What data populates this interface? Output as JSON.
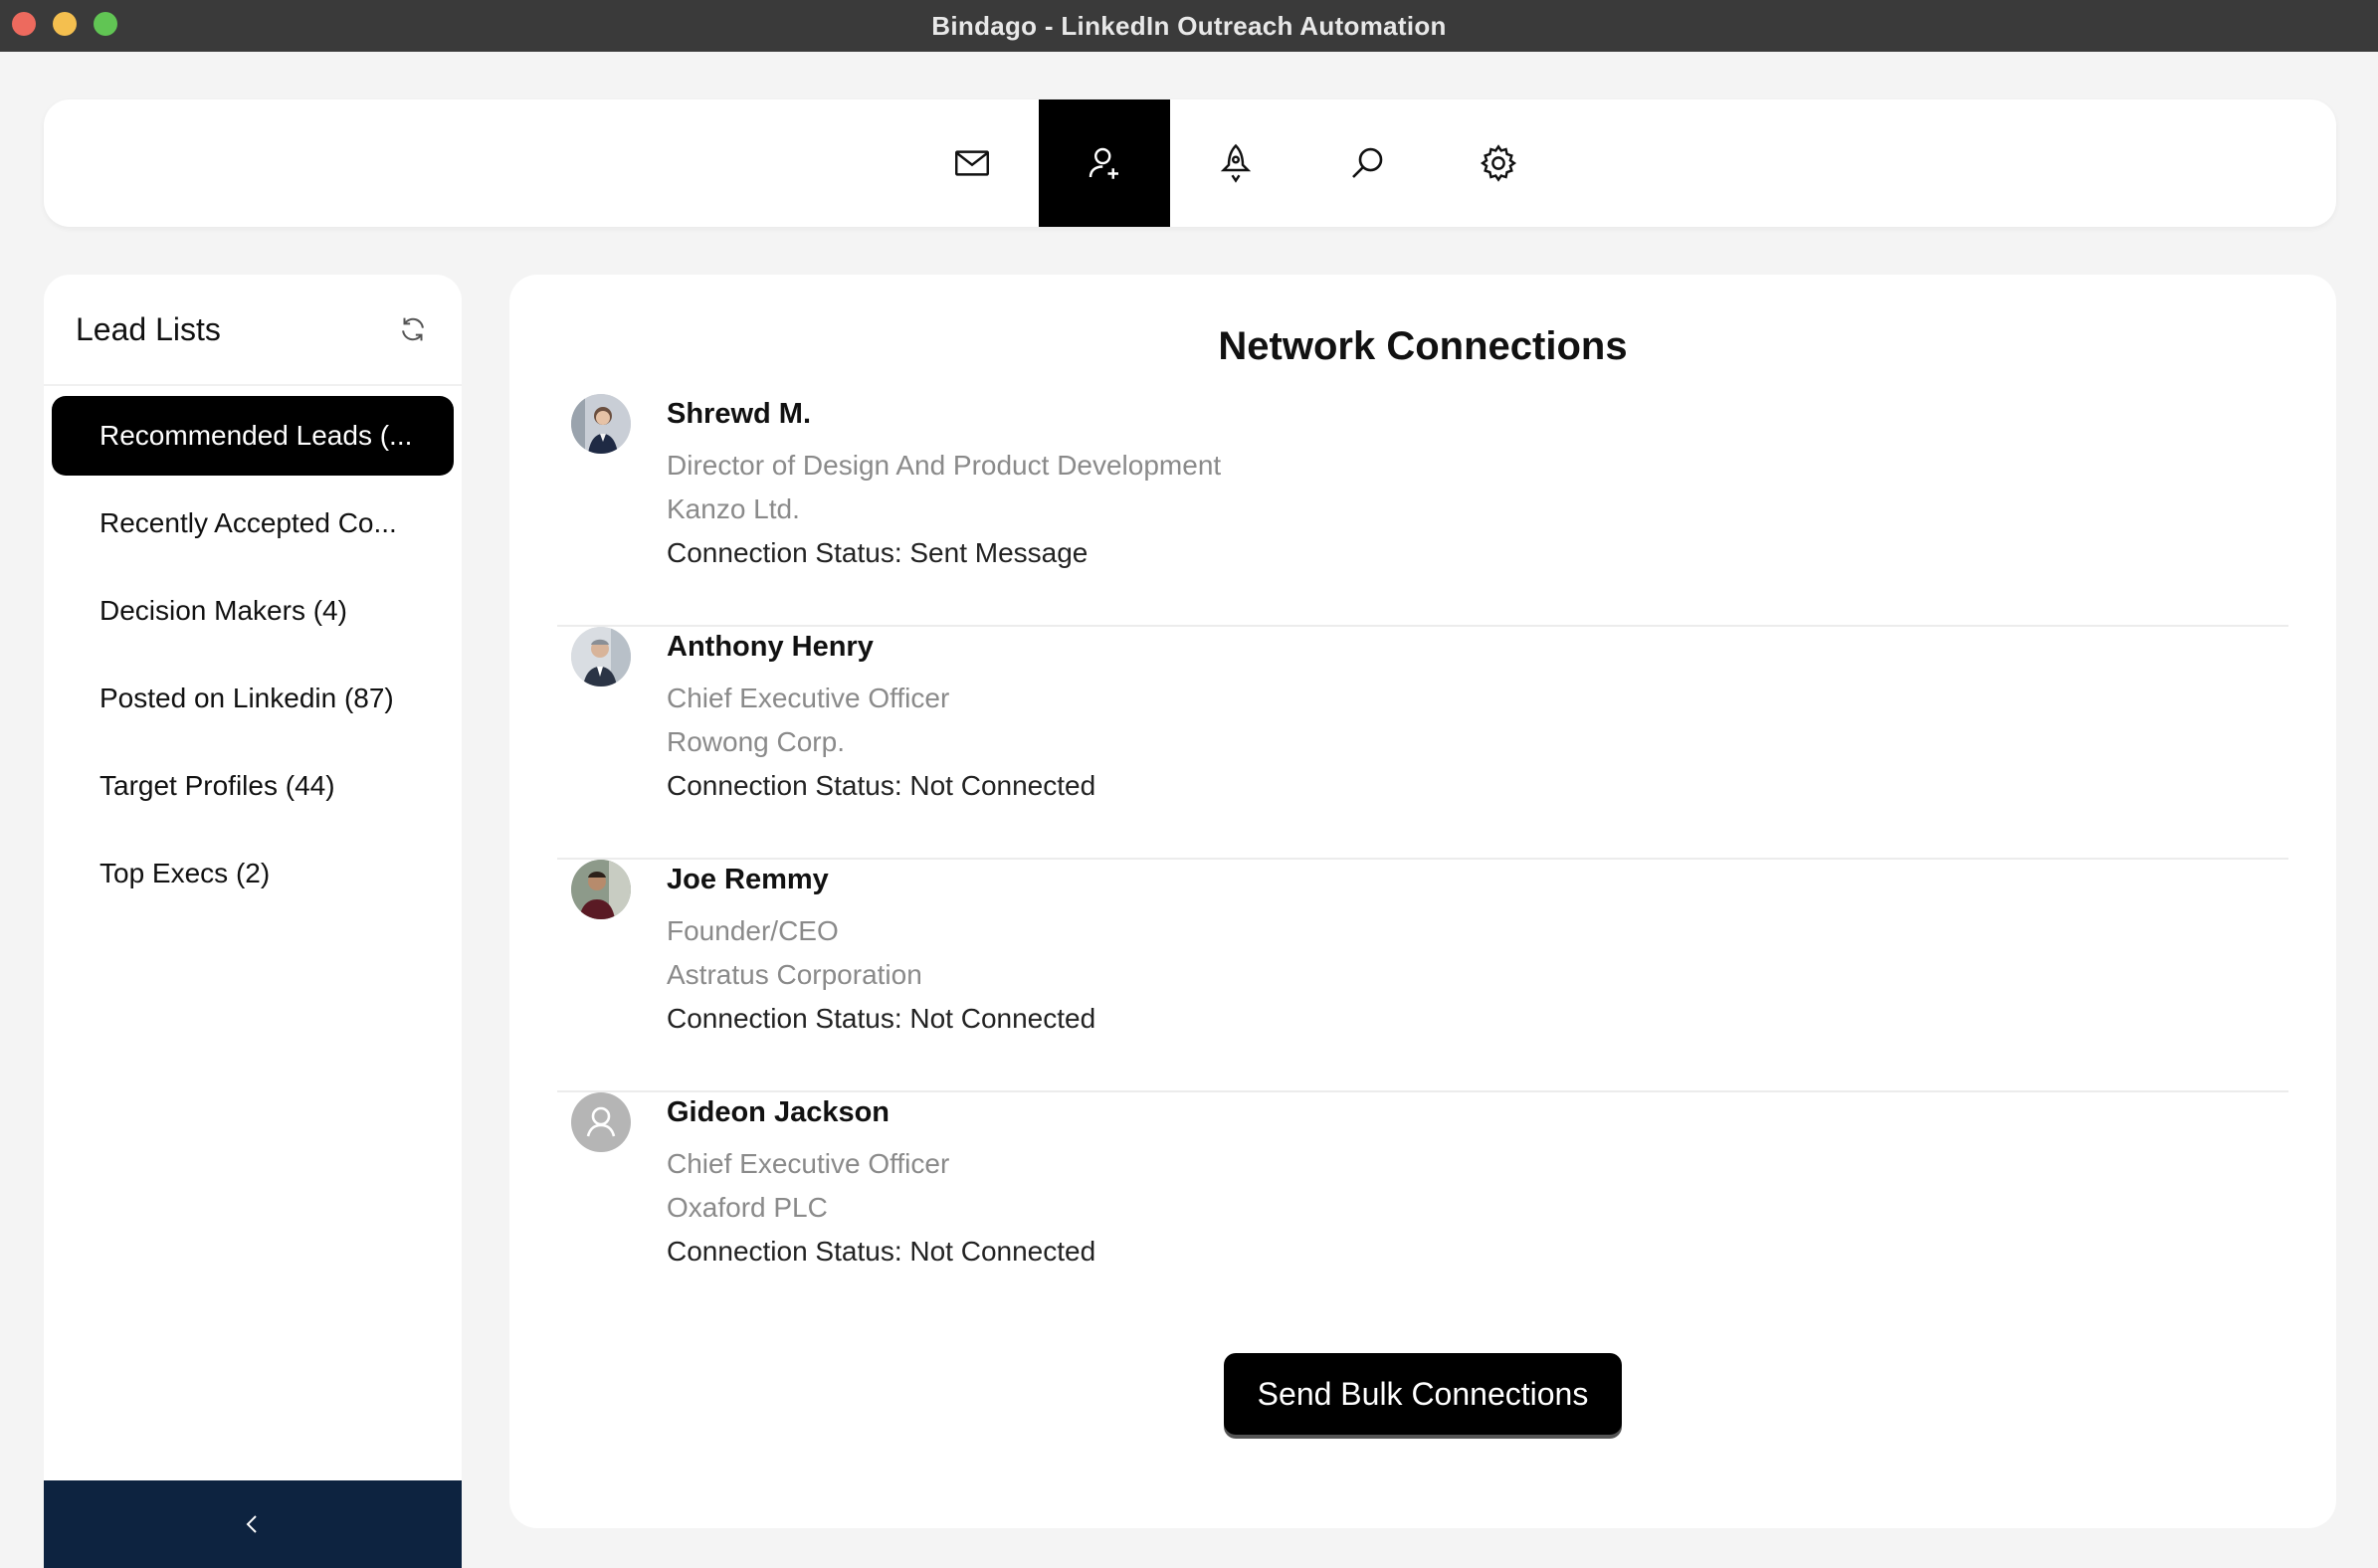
{
  "window": {
    "title": "Bindago - LinkedIn Outreach Automation"
  },
  "nav": {
    "items": [
      {
        "icon": "mail-icon",
        "active": false
      },
      {
        "icon": "add-person-icon",
        "active": true
      },
      {
        "icon": "rocket-icon",
        "active": false
      },
      {
        "icon": "search-icon",
        "active": false
      },
      {
        "icon": "gear-icon",
        "active": false
      }
    ]
  },
  "sidebar": {
    "title": "Lead Lists",
    "items": [
      {
        "label": "Recommended Leads (...",
        "active": true
      },
      {
        "label": "Recently Accepted Co...",
        "active": false
      },
      {
        "label": "Decision Makers (4)",
        "active": false
      },
      {
        "label": "Posted on Linkedin (87)",
        "active": false
      },
      {
        "label": "Target Profiles (44)",
        "active": false
      },
      {
        "label": "Top Execs (2)",
        "active": false
      }
    ],
    "collapse_icon": "chevron-left-icon"
  },
  "main": {
    "title": "Network Connections",
    "connections": [
      {
        "name": "Shrewd M.",
        "title": "Director of Design And Product Development",
        "company": "Kanzo Ltd.",
        "status": "Connection Status: Sent Message"
      },
      {
        "name": "Anthony Henry",
        "title": "Chief Executive Officer",
        "company": "Rowong Corp.",
        "status": "Connection Status: Not Connected"
      },
      {
        "name": "Joe Remmy",
        "title": "Founder/CEO",
        "company": "Astratus Corporation",
        "status": "Connection Status: Not Connected"
      },
      {
        "name": "Gideon Jackson",
        "title": "Chief Executive Officer",
        "company": "Oxaford PLC",
        "status": "Connection Status: Not Connected"
      }
    ],
    "bulk_button": "Send Bulk Connections"
  },
  "colors": {
    "accent": "#000000",
    "collapse_bar": "#0d2340",
    "muted_text": "#8a8a8a"
  }
}
